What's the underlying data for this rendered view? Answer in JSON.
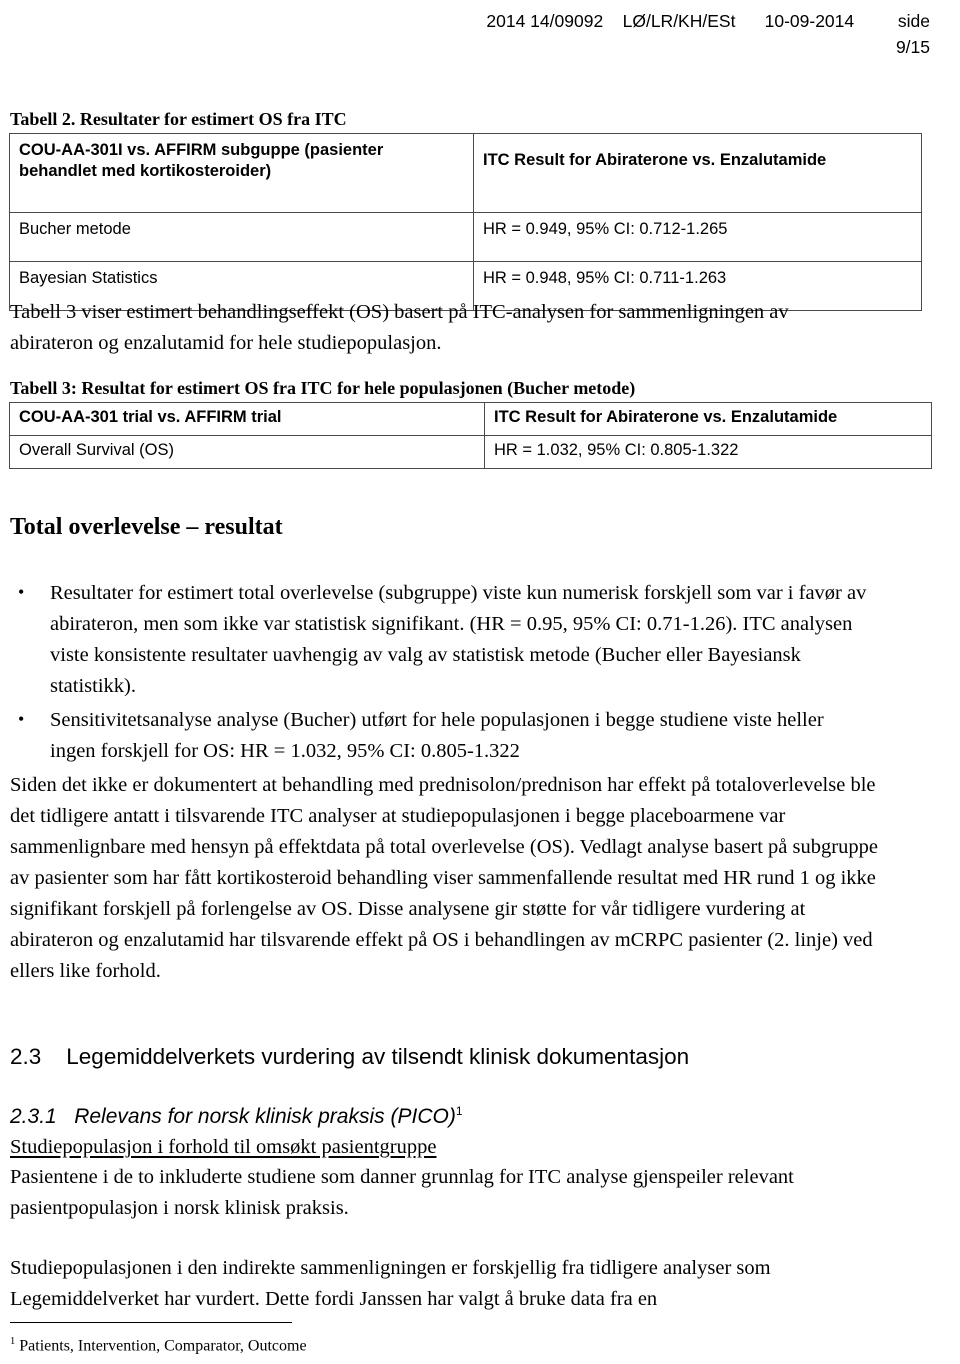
{
  "header": {
    "line1": "2014 14/09092    LØ/LR/KH/ESt      10-09-2014         side",
    "line2": "9/15"
  },
  "table2": {
    "caption": "Tabell 2. Resultater for estimert OS fra ITC",
    "columns": [
      "COU-AA-301I vs. AFFIRM subguppe (pasienter behandlet med kortikosteroider)",
      "ITC Result  for Abiraterone vs. Enzalutamide"
    ],
    "rows": [
      {
        "label": "Bucher metode",
        "value": "HR = 0.949, 95% CI: 0.712-1.265"
      },
      {
        "label": "Bayesian Statistics",
        "value": "HR = 0.948, 95% CI: 0.711-1.263"
      }
    ]
  },
  "intro_paragraph": "Tabell 3 viser estimert behandlingseffekt (OS) basert på ITC-analysen for sammenligningen av abirateron og enzalutamid for hele studiepopulasjon.",
  "table3": {
    "caption": "Tabell 3: Resultat for estimert OS fra ITC for hele populasjonen (Bucher metode)",
    "columns": [
      "COU-AA-301 trial vs. AFFIRM trial",
      "ITC Result  for Abiraterone vs. Enzalutamide"
    ],
    "rows": [
      {
        "label": "Overall Survival (OS)",
        "value": "HR = 1.032, 95% CI: 0.805-1.322"
      }
    ]
  },
  "survival_section": {
    "heading": "Total overlevelse – resultat",
    "bullets": [
      "Resultater for estimert total overlevelse (subgruppe) viste kun numerisk forskjell som var i favør av abirateron, men som ikke var statistisk signifikant. (HR = 0.95, 95% CI: 0.71-1.26). ITC analysen viste konsistente resultater uavhengig av valg av statistisk metode (Bucher eller Bayesiansk statistikk).",
      "Sensitivitetsanalyse analyse (Bucher) utført for hele populasjonen i begge studiene viste heller ingen forskjell for OS: HR = 1.032, 95% CI: 0.805-1.322"
    ],
    "paragraph": "Siden det ikke er dokumentert at behandling med prednisolon/prednison har effekt på totaloverlevelse ble det tidligere antatt i tilsvarende ITC analyser at studiepopulasjonen i begge placeboarmene var sammenlignbare med hensyn på effektdata på total overlevelse (OS). Vedlagt analyse basert på subgruppe av pasienter som har fått kortikosteroid behandling viser sammenfallende resultat med HR rund 1 og ikke signifikant forskjell på forlengelse av OS. Disse analysene gir støtte for vår tidligere vurdering at abirateron og enzalutamid har tilsvarende effekt på OS i behandlingen av mCRPC pasienter (2. linje) ved ellers like forhold."
  },
  "section_23": {
    "heading": "2.3    Legemiddelverkets vurdering av tilsendt klinisk dokumentasjon"
  },
  "section_231": {
    "heading": "2.3.1   Relevans for norsk klinisk praksis (PICO)",
    "heading_superscript": "1",
    "subheading": "Studiepopulasjon i forhold til omsøkt pasientgruppe",
    "paragraph1": "Pasientene i de to inkluderte studiene som danner grunnlag for ITC analyse gjenspeiler relevant pasientpopulasjon i norsk klinisk praksis.",
    "paragraph2": "Studiepopulasjonen i den indirekte sammenligningen er forskjellig fra tidligere analyser som Legemiddelverket har vurdert. Dette fordi Janssen har valgt å bruke data fra en"
  },
  "footnote": {
    "marker": "1",
    "text": " Patients, Intervention, Comparator, Outcome"
  }
}
